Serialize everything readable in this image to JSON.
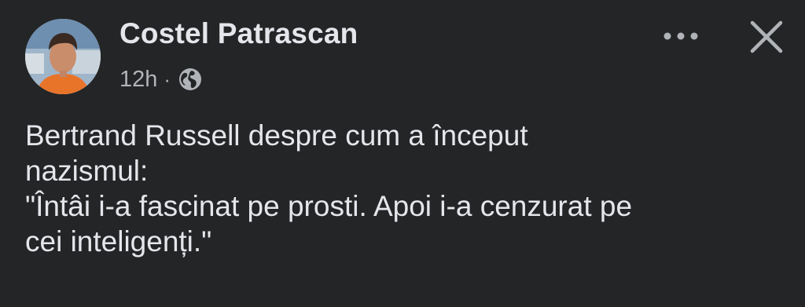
{
  "post": {
    "author": "Costel Patrascan",
    "time": "12h",
    "separator": "·",
    "privacy_icon": "globe-icon",
    "text_lines": [
      "Bertrand Russell despre cum a început",
      "nazismul:",
      "\"Întâi i-a fascinat pe prosti. Apoi i-a cenzurat pe",
      "cei inteligenți.\""
    ]
  },
  "actions": {
    "more_icon": "more-options-icon",
    "close_icon": "close-icon"
  },
  "colors": {
    "background": "#242526",
    "primary_text": "#e4e6eb",
    "secondary_text": "#b0b3b8"
  }
}
